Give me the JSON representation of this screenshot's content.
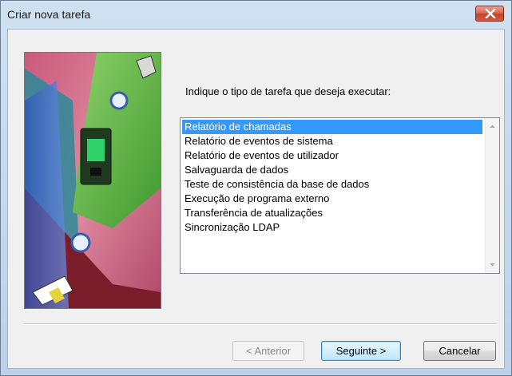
{
  "window": {
    "title": "Criar nova tarefa",
    "close_icon": "close-icon"
  },
  "prompt": "Indique o tipo de tarefa que deseja executar:",
  "task_list": {
    "items": [
      "Relatório de chamadas",
      "Relatório de eventos de sistema",
      "Relatório de eventos de utilizador",
      "Salvaguarda de dados",
      "Teste de consistência da base de dados",
      "Execução de programa externo",
      "Transferência de atualizações",
      "Sincronização LDAP"
    ],
    "selected_index": 0
  },
  "buttons": {
    "back": "< Anterior",
    "next": "Seguinte >",
    "cancel": "Cancelar"
  },
  "colors": {
    "selection": "#3399ff",
    "close": "#c7472c"
  }
}
